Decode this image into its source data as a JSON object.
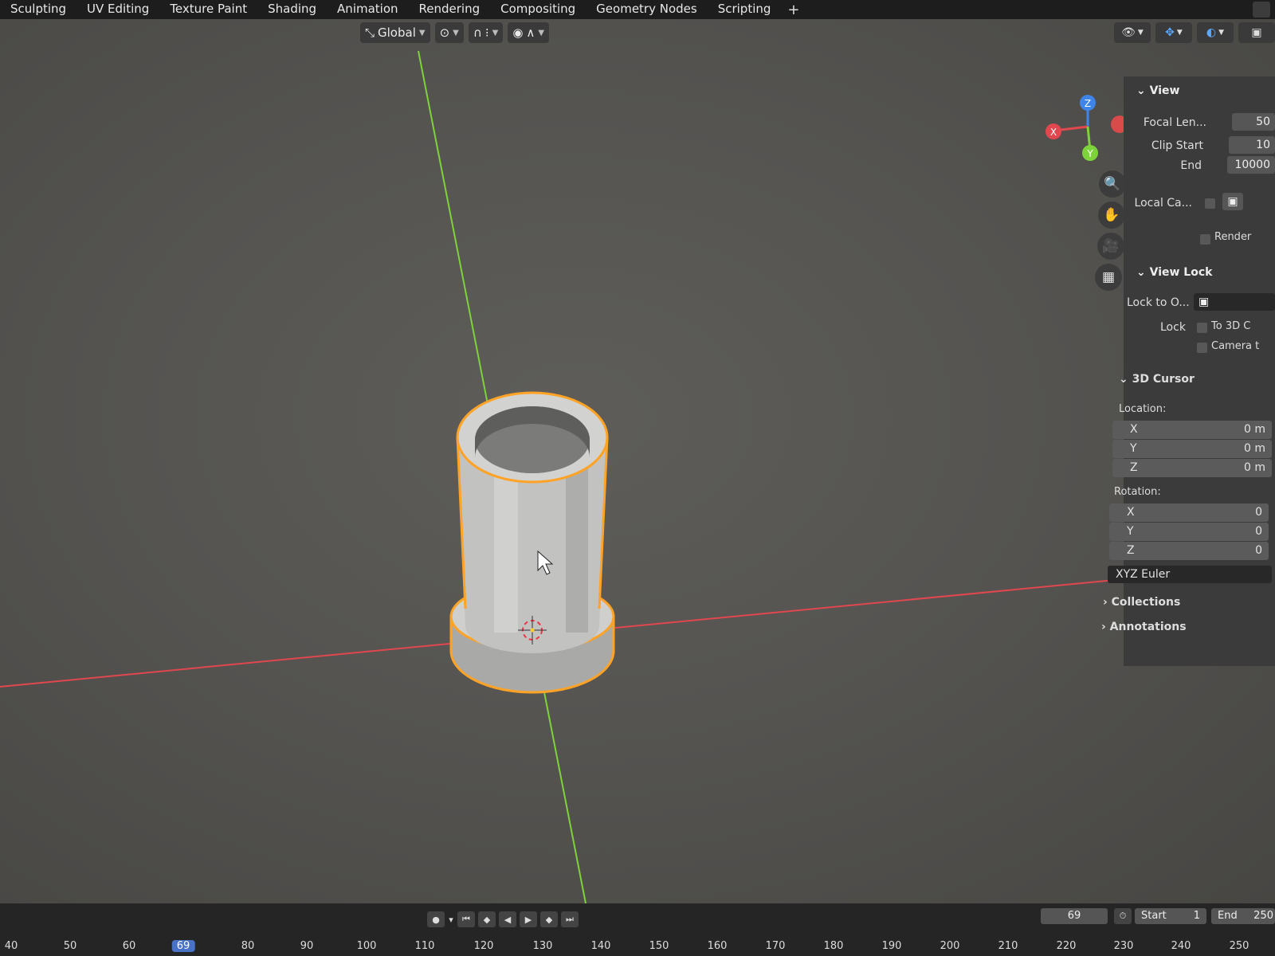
{
  "workspace_tabs": [
    "Sculpting",
    "UV Editing",
    "Texture Paint",
    "Shading",
    "Animation",
    "Rendering",
    "Compositing",
    "Geometry Nodes",
    "Scripting"
  ],
  "add_tab": "+",
  "header": {
    "transform_orientation": "Global"
  },
  "n_panel": {
    "view": {
      "title": "View",
      "focal_length_label": "Focal Len...",
      "focal_length_value": "50",
      "clip_start_label": "Clip Start",
      "clip_start_value": "10",
      "clip_end_label": "End",
      "clip_end_value": "10000",
      "local_camera_label": "Local Ca...",
      "render_region_label": "Render"
    },
    "view_lock": {
      "title": "View Lock",
      "lock_to_object_label": "Lock to O...",
      "lock_label": "Lock",
      "to_3d_cursor_label": "To 3D C",
      "camera_label": "Camera t"
    },
    "cursor": {
      "title": "3D Cursor",
      "location_label": "Location:",
      "loc": [
        {
          "axis": "X",
          "value": "0 m"
        },
        {
          "axis": "Y",
          "value": "0 m"
        },
        {
          "axis": "Z",
          "value": "0 m"
        }
      ],
      "rotation_label": "Rotation:",
      "rot": [
        {
          "axis": "X",
          "value": "0"
        },
        {
          "axis": "Y",
          "value": "0"
        },
        {
          "axis": "Z",
          "value": "0"
        }
      ],
      "rotation_mode": "XYZ Euler"
    },
    "collections_label": "Collections",
    "annotations_label": "Annotations"
  },
  "gizmo": {
    "x": "X",
    "y": "Y",
    "z": "Z"
  },
  "timeline": {
    "current_frame": "69",
    "start_label": "Start",
    "start_value": "1",
    "end_label": "End",
    "end_value": "250",
    "ticks": [
      "40",
      "50",
      "60",
      "69",
      "80",
      "90",
      "100",
      "110",
      "120",
      "130",
      "140",
      "150",
      "160",
      "170",
      "180",
      "190",
      "200",
      "210",
      "220",
      "230",
      "240",
      "250"
    ]
  },
  "colors": {
    "x_axis": "#e0474e",
    "y_axis": "#7ed23a",
    "z_axis": "#3f85e8",
    "selection_outline": "#ffa326",
    "current_frame": "#4772c6"
  }
}
